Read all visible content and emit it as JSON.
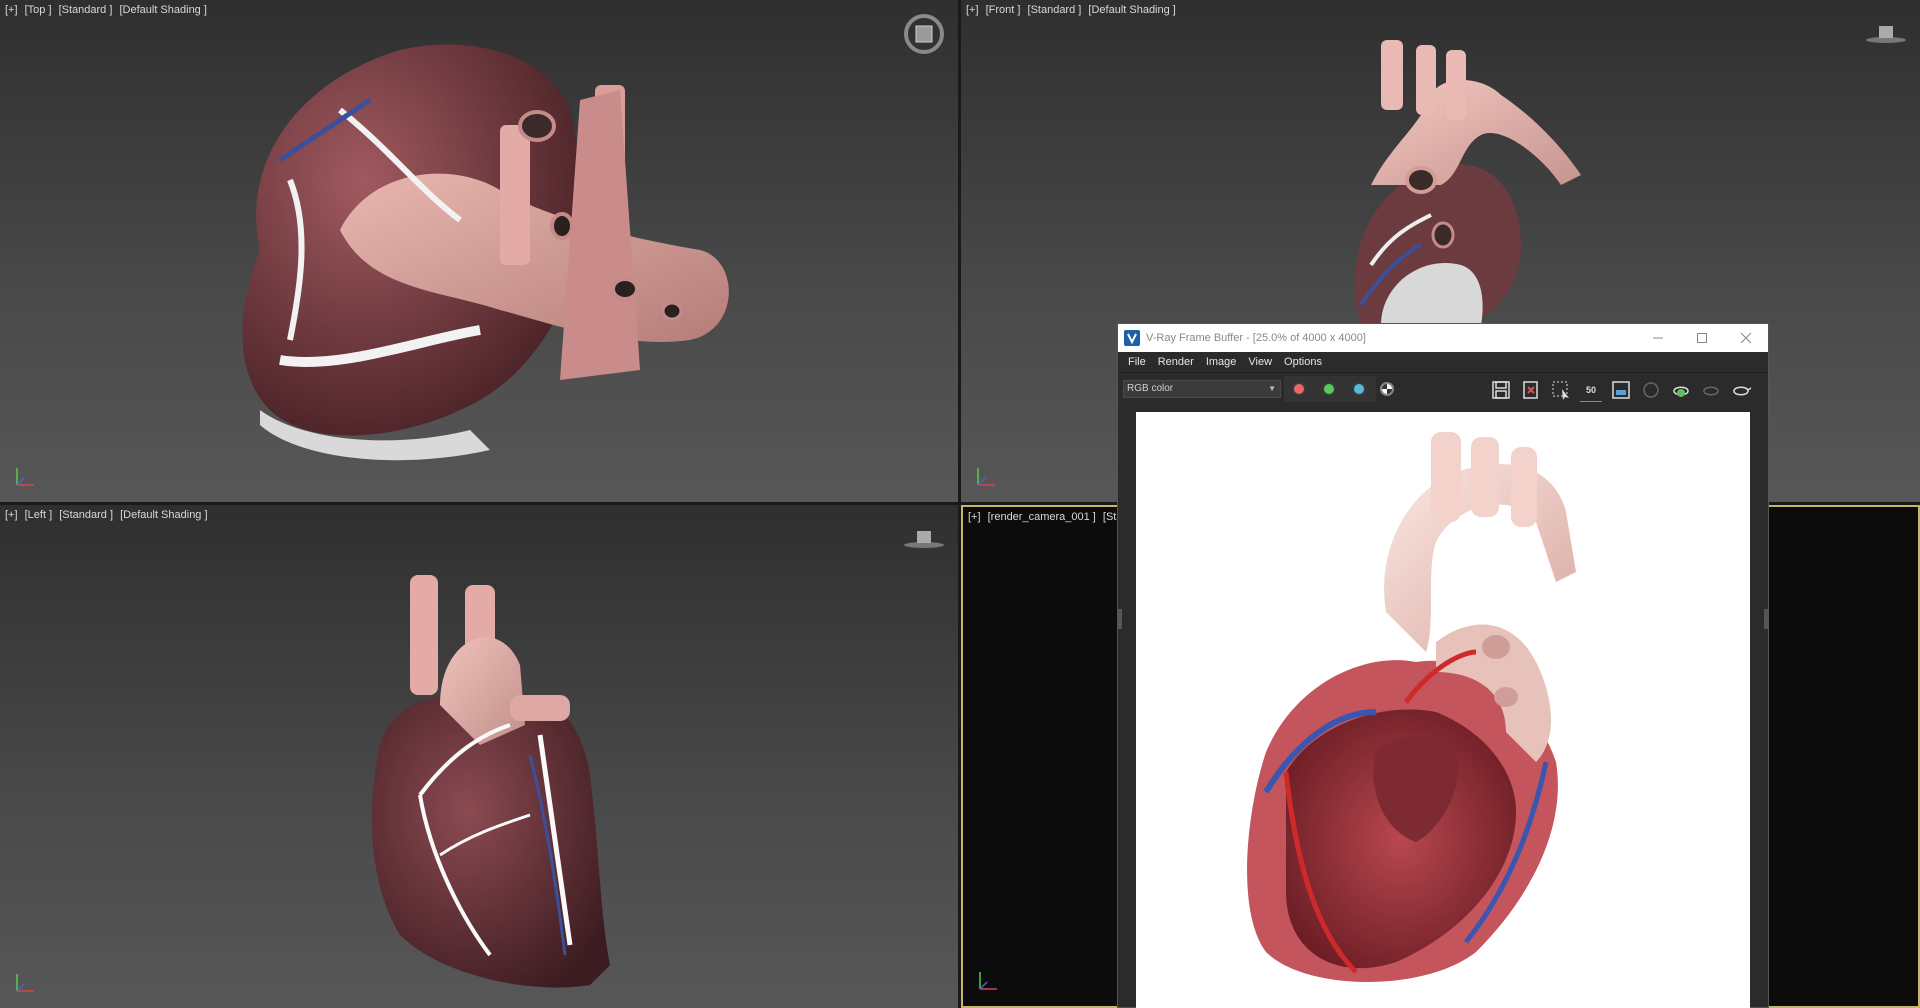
{
  "viewports": {
    "top": {
      "plus": "[+]",
      "view": "[Top ]",
      "mode": "[Standard ]",
      "shading": "[Default Shading ]"
    },
    "front": {
      "plus": "[+]",
      "view": "[Front ]",
      "mode": "[Standard ]",
      "shading": "[Default Shading ]"
    },
    "left": {
      "plus": "[+]",
      "view": "[Left ]",
      "mode": "[Standard ]",
      "shading": "[Default Shading ]"
    },
    "camera": {
      "plus": "[+]",
      "view": "[render_camera_001 ]",
      "mode": "[Stan"
    }
  },
  "vfb": {
    "title": "V-Ray Frame Buffer - [25.0% of 4000 x 4000]",
    "menu": [
      "File",
      "Render",
      "Image",
      "View",
      "Options"
    ],
    "channel": "RGB color",
    "channel_colors": {
      "red": "#e66666",
      "green": "#55cc55",
      "blue": "#55bbdd"
    },
    "toolbar_icons": [
      "save-icon",
      "clear-icon",
      "region-select-icon",
      "zoom-50-icon",
      "frame-icon",
      "track-mouse-icon",
      "render-teapot-icon",
      "render-stop-icon",
      "render-teapot-2-icon"
    ],
    "zoom_label": "50"
  },
  "colors": {
    "accent_frame": "#c8b56a",
    "viewport_bg": "#444444"
  }
}
